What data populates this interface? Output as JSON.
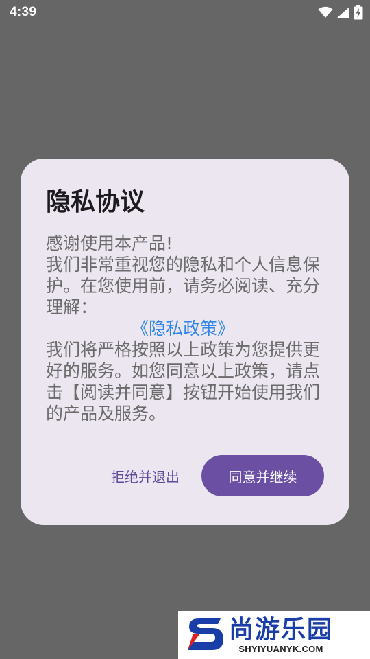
{
  "status_bar": {
    "time": "4:39",
    "icons": [
      "wifi-icon",
      "signal-icon",
      "battery-icon"
    ]
  },
  "dialog": {
    "title": "隐私协议",
    "body_intro": "感谢使用本产品!",
    "body_p1": "我们非常重视您的隐私和个人信息保护。在您使用前，请务必阅读、充分理解：",
    "privacy_link": "《隐私政策》",
    "body_p2": "我们将严格按照以上政策为您提供更好的服务。如您同意以上政策，请点击【阅读并同意】按钮开始使用我们的产品及服务。",
    "reject_label": "拒绝并退出",
    "accept_label": "同意并继续"
  },
  "watermark": {
    "cn": "尚游乐园",
    "en": "SHYIYUANYK.COM"
  },
  "colors": {
    "scrim": "#666666",
    "dialog_bg": "#ebe6f0",
    "accent": "#6a4fa3",
    "link": "#2f86e8"
  }
}
